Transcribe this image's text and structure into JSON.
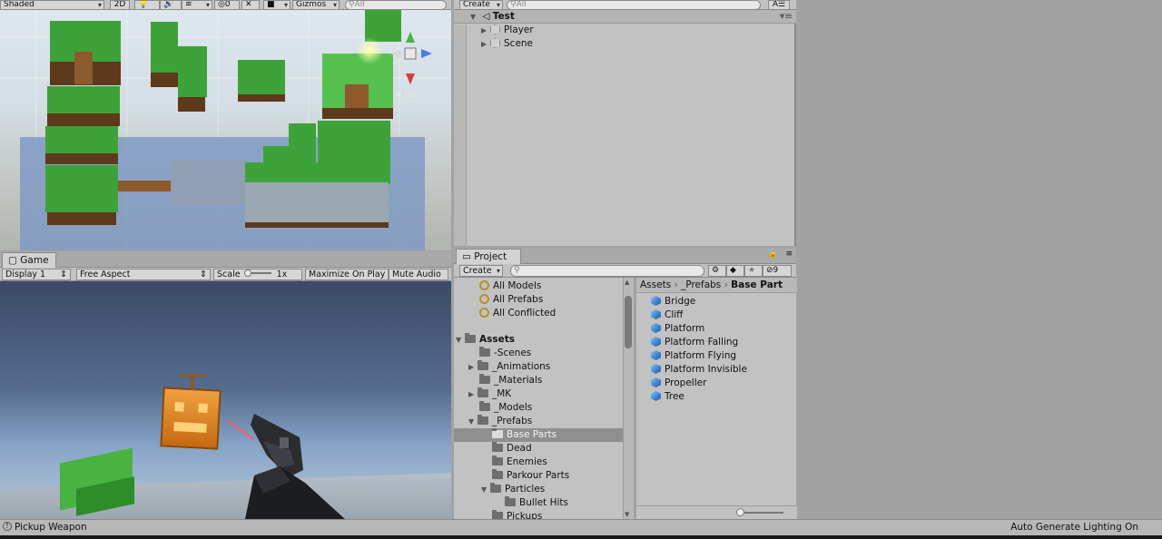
{
  "scene": {
    "shading_mode": "Shaded",
    "mode_2d": "2D",
    "hidden_count": "0",
    "gizmos_label": "Gizmos",
    "search_placeholder": "All",
    "projection_label": "Iso"
  },
  "hierarchy": {
    "create_label": "Create",
    "search_placeholder": "All",
    "scene_name": "Test",
    "items": [
      "Player",
      "Scene"
    ]
  },
  "game": {
    "tab_label": "Game",
    "display_label": "Display 1",
    "aspect_label": "Free Aspect",
    "scale_label": "Scale",
    "scale_value": "1x",
    "maximize_label": "Maximize On Play",
    "mute_label": "Mute Audio"
  },
  "project": {
    "tab_label": "Project",
    "create_label": "Create",
    "hidden_packages_count": "9",
    "favorites": [
      "All Models",
      "All Prefabs",
      "All Conflicted"
    ],
    "assets_root": "Assets",
    "folders": [
      {
        "label": "-Scenes",
        "expandable": false
      },
      {
        "label": "_Animations",
        "expandable": true
      },
      {
        "label": "_Materials",
        "expandable": false
      },
      {
        "label": "_MK",
        "expandable": true
      },
      {
        "label": "_Models",
        "expandable": false
      },
      {
        "label": "_Prefabs",
        "expandable": true,
        "expanded": true
      }
    ],
    "prefab_subfolders": [
      "Base Parts",
      "Dead",
      "Enemies",
      "Parkour Parts",
      "Particles"
    ],
    "particles_subfolders": [
      "Bullet Hits"
    ],
    "cut_folder": "Pickups",
    "selected_folder": "Base Parts",
    "breadcrumb": [
      "Assets",
      "_Prefabs",
      "Base Part"
    ],
    "assets": [
      "Bridge",
      "Cliff",
      "Platform",
      "Platform Falling",
      "Platform Flying",
      "Platform Invisible",
      "Propeller",
      "Tree"
    ]
  },
  "status": {
    "message": "Pickup Weapon",
    "right_text": "Auto Generate Lighting On"
  },
  "colors": {
    "panel": "#c2c2c2",
    "selection": "#8f8f8f",
    "empty": "#a2a2a2",
    "accent_cube": "#3a7fd0"
  }
}
